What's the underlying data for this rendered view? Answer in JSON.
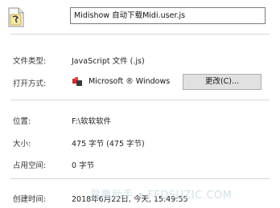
{
  "file": {
    "name_value": "Midishow 自动下载Midi.user.js"
  },
  "rows": {
    "type": {
      "label": "文件类型:",
      "value": "JavaScript 文件 (.js)"
    },
    "opens_with": {
      "label": "打开方式:",
      "app_name": "Microsoft ® Windows",
      "change_label": "更改(C)..."
    },
    "location": {
      "label": "位置:",
      "value": "F:\\软软软件"
    },
    "size": {
      "label": "大小:",
      "value": "475 字节 (475 字节)"
    },
    "size_on_disk": {
      "label": "占用空间:",
      "value": "0 字节"
    },
    "created": {
      "label": "创建时间:",
      "value": "2018年6月22日, 今天, 15:49:55"
    }
  },
  "watermark": "易惠助手 • FFDSUZIC.COM",
  "icons": {
    "file_icon": "javascript-file-icon",
    "app_icon": "windows-script-host-icon"
  }
}
